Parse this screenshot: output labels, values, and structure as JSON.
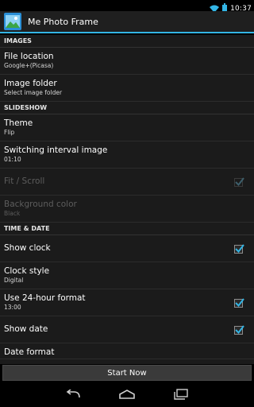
{
  "status_bar": {
    "time": "10:37",
    "icons": [
      "wifi-icon",
      "battery-icon"
    ]
  },
  "action_bar": {
    "title": "Me Photo Frame",
    "icon": "app-photo-icon"
  },
  "sections": [
    {
      "header": "IMAGES",
      "items": [
        {
          "title": "File location",
          "summary": "Google+(Picasa)"
        },
        {
          "title": "Image folder",
          "summary": "Select image folder"
        }
      ]
    },
    {
      "header": "SLIDESHOW",
      "items": [
        {
          "title": "Theme",
          "summary": "Flip"
        },
        {
          "title": "Switching interval image",
          "summary": "01:10"
        },
        {
          "title": "Fit / Scroll",
          "checked": true,
          "enabled": false
        },
        {
          "title": "Background color",
          "summary": "Black",
          "enabled": false
        }
      ]
    },
    {
      "header": "TIME & DATE",
      "items": [
        {
          "title": "Show clock",
          "checked": true
        },
        {
          "title": "Clock style",
          "summary": "Digital"
        },
        {
          "title": "Use 24-hour format",
          "summary": "13:00",
          "checked": true
        },
        {
          "title": "Show date",
          "checked": true
        },
        {
          "title": "Date format"
        }
      ]
    }
  ],
  "bottom": {
    "start_label": "Start Now"
  },
  "nav_bar": {
    "icons": [
      "back-icon",
      "home-icon",
      "recent-apps-icon"
    ]
  },
  "colors": {
    "accent": "#33b5e5",
    "background": "#1b1b1b",
    "disabled_text": "#5d5d5d"
  }
}
